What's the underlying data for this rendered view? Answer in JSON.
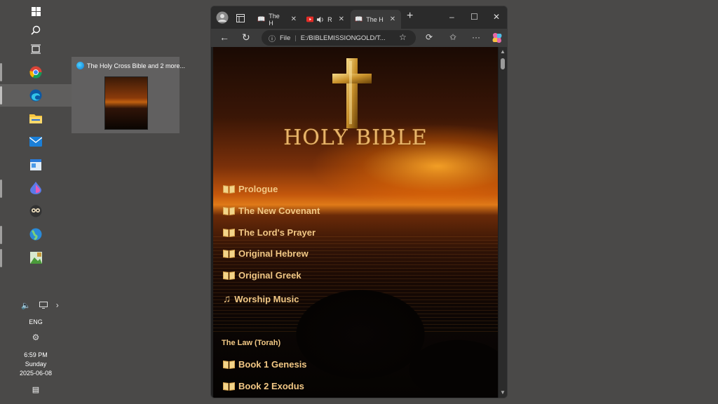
{
  "taskbar": {
    "tray_language": "ENG",
    "clock_time": "6:59 PM",
    "clock_day": "Sunday",
    "clock_date": "2025-06-08"
  },
  "preview": {
    "title": "The Holy Cross Bible and 2 more..."
  },
  "browser": {
    "tabs": [
      {
        "label": "The H"
      },
      {
        "label": "R"
      },
      {
        "label": "The H"
      }
    ],
    "address": {
      "file_label": "File",
      "url": "E:/BIBLEMISSIONGOLD/T..."
    }
  },
  "page": {
    "title": "HOLY BIBLE",
    "menu": [
      {
        "label": "Prologue",
        "icon": "book-icon"
      },
      {
        "label": "The New Covenant",
        "icon": "book-icon"
      },
      {
        "label": "The Lord's Prayer",
        "icon": "book-icon"
      },
      {
        "label": "Original Hebrew",
        "icon": "book-icon"
      },
      {
        "label": "Original Greek",
        "icon": "book-icon"
      },
      {
        "label": "Worship Music",
        "icon": "music-note-icon"
      }
    ],
    "section_title": "The Law (Torah)",
    "books": [
      {
        "label": "Book 1 Genesis"
      },
      {
        "label": "Book 2 Exodus"
      }
    ]
  },
  "colors": {
    "gold": "#f2c885",
    "title_gold": "#e8b46a",
    "chrome_dark": "#2b2b2b"
  }
}
